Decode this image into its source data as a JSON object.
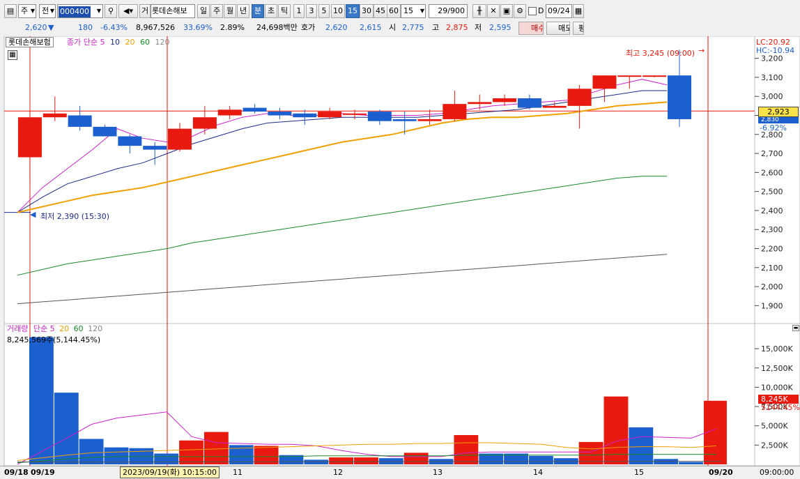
{
  "toolbar": {
    "type_select": "주",
    "market_select": "전",
    "code": "000400",
    "cat_btn": "거",
    "stock_name": "롯데손해보",
    "period_btns": [
      "일",
      "주",
      "월",
      "년",
      "분",
      "초",
      "틱"
    ],
    "interval_btns": [
      "1",
      "3",
      "5",
      "10",
      "15",
      "30",
      "45",
      "60"
    ],
    "interval_value": "15",
    "count": "29/900",
    "d_label": "D",
    "date_value": "09/24"
  },
  "quote": {
    "price": "2,620",
    "arrow": "▼",
    "change": "180",
    "change_pct": "-6.43%",
    "volume": "8,967,526",
    "turnover_pct": "33.69%",
    "vol_ratio": "2.89%",
    "amount": "24,698백만",
    "hoga_label": "호가",
    "ask": "2,620",
    "bid": "2,615",
    "open_label": "시",
    "open": "2,775",
    "high_label": "고",
    "high": "2,875",
    "low_label": "저",
    "low": "2,595",
    "buy_btn": "매수",
    "sell_btn": "매도",
    "eval_btn": "평"
  },
  "price_panel": {
    "stock_label": "롯데손해보험",
    "ma_legend": {
      "label": "종가 단순",
      "periods": [
        "5",
        "10",
        "20",
        "60",
        "120"
      ]
    },
    "max_annotation": "최고 3,245 (09:00)",
    "min_annotation": "최저 2,390 (15:30)",
    "lc_label": "LC:20.92",
    "hc_label": "HC:-10.94",
    "current_price_tag": "2,923",
    "hidden_tag": "2,830",
    "pct_tag": "-6.92%",
    "colors": {
      "up": "#e8190e",
      "down": "#1c5fcf",
      "ma5": "#cc22cc",
      "ma10": "#1a2a8a",
      "ma20": "#f0a000",
      "ma60": "#1a8a2a",
      "ma120": "#555555"
    }
  },
  "volume_panel": {
    "label": "거래량",
    "ma_legend": {
      "label": "단순",
      "periods": [
        "5",
        "20",
        "60",
        "120"
      ]
    },
    "info": "8,245,569주(5,144.45%)",
    "current_tag": "8,245K",
    "pct_tag": "5144.45%"
  },
  "xaxis": {
    "labels": [
      "09/18",
      "09/19",
      "11",
      "12",
      "13",
      "14",
      "15",
      "09/20"
    ],
    "crosshair_date": "2023/09/19(화) 10:15:00",
    "right_time": "09:00:00"
  },
  "chart_data": [
    {
      "type": "candlestick",
      "title": "롯데손해보험",
      "ylim": [
        1850,
        3250
      ],
      "yticks": [
        1900,
        2000,
        2100,
        2200,
        2300,
        2400,
        2500,
        2600,
        2700,
        2800,
        2900,
        3000,
        3100,
        3200
      ],
      "candles": [
        {
          "o": 2890,
          "h": 2910,
          "l": 2560,
          "c": 2680,
          "dir": "down",
          "color": "red"
        },
        {
          "o": 2890,
          "h": 3000,
          "l": 2870,
          "c": 2910,
          "dir": "up"
        },
        {
          "o": 2900,
          "h": 2950,
          "l": 2820,
          "c": 2840,
          "dir": "down"
        },
        {
          "o": 2840,
          "h": 2850,
          "l": 2790,
          "c": 2790,
          "dir": "down"
        },
        {
          "o": 2790,
          "h": 2800,
          "l": 2700,
          "c": 2740,
          "dir": "down"
        },
        {
          "o": 2740,
          "h": 2760,
          "l": 2640,
          "c": 2720,
          "dir": "down"
        },
        {
          "o": 2720,
          "h": 2860,
          "l": 2710,
          "c": 2830,
          "dir": "up"
        },
        {
          "o": 2830,
          "h": 2950,
          "l": 2800,
          "c": 2890,
          "dir": "up"
        },
        {
          "o": 2900,
          "h": 2950,
          "l": 2880,
          "c": 2930,
          "dir": "up"
        },
        {
          "o": 2940,
          "h": 2960,
          "l": 2910,
          "c": 2920,
          "dir": "down"
        },
        {
          "o": 2920,
          "h": 2940,
          "l": 2880,
          "c": 2900,
          "dir": "down"
        },
        {
          "o": 2910,
          "h": 2930,
          "l": 2850,
          "c": 2890,
          "dir": "down"
        },
        {
          "o": 2890,
          "h": 2940,
          "l": 2880,
          "c": 2920,
          "dir": "up"
        },
        {
          "o": 2910,
          "h": 2930,
          "l": 2880,
          "c": 2910,
          "dir": "flat"
        },
        {
          "o": 2920,
          "h": 2930,
          "l": 2850,
          "c": 2870,
          "dir": "down"
        },
        {
          "o": 2880,
          "h": 2920,
          "l": 2800,
          "c": 2870,
          "dir": "down"
        },
        {
          "o": 2870,
          "h": 2930,
          "l": 2850,
          "c": 2880,
          "dir": "up"
        },
        {
          "o": 2880,
          "h": 3030,
          "l": 2870,
          "c": 2960,
          "dir": "up"
        },
        {
          "o": 2960,
          "h": 3010,
          "l": 2930,
          "c": 2970,
          "dir": "up"
        },
        {
          "o": 2970,
          "h": 3010,
          "l": 2950,
          "c": 2990,
          "dir": "up"
        },
        {
          "o": 2990,
          "h": 3010,
          "l": 2930,
          "c": 2940,
          "dir": "down"
        },
        {
          "o": 2940,
          "h": 2970,
          "l": 2940,
          "c": 2950,
          "dir": "flat"
        },
        {
          "o": 2950,
          "h": 3060,
          "l": 2830,
          "c": 3040,
          "dir": "up"
        },
        {
          "o": 3040,
          "h": 3110,
          "l": 2970,
          "c": 3110,
          "dir": "up"
        },
        {
          "o": 3110,
          "h": 3110,
          "l": 3040,
          "c": 3110,
          "dir": "flat"
        },
        {
          "o": 3110,
          "h": 3110,
          "l": 3100,
          "c": 3110,
          "dir": "flat"
        },
        {
          "o": 3110,
          "h": 3245,
          "l": 2840,
          "c": 2880,
          "dir": "down"
        }
      ],
      "ma": {
        "ma5": [
          2390,
          2520,
          2620,
          2720,
          2830,
          2780,
          2760,
          2790,
          2850,
          2890,
          2910,
          2900,
          2900,
          2910,
          2900,
          2900,
          2900,
          2910,
          2930,
          2950,
          2960,
          2970,
          2980,
          3020,
          3060,
          3090,
          3060
        ],
        "ma10": [
          2390,
          2470,
          2540,
          2580,
          2620,
          2650,
          2700,
          2750,
          2790,
          2830,
          2860,
          2870,
          2880,
          2890,
          2890,
          2890,
          2890,
          2900,
          2910,
          2920,
          2930,
          2950,
          2970,
          2990,
          3010,
          3030,
          3030
        ],
        "ma20": [
          2390,
          2420,
          2450,
          2480,
          2500,
          2520,
          2550,
          2580,
          2610,
          2640,
          2670,
          2700,
          2730,
          2760,
          2780,
          2800,
          2830,
          2860,
          2880,
          2890,
          2890,
          2900,
          2910,
          2930,
          2950,
          2960,
          2970
        ],
        "ma60": [
          2060,
          2090,
          2120,
          2140,
          2160,
          2180,
          2200,
          2230,
          2250,
          2270,
          2290,
          2310,
          2330,
          2350,
          2370,
          2390,
          2410,
          2430,
          2450,
          2470,
          2490,
          2510,
          2530,
          2550,
          2570,
          2580,
          2580
        ],
        "ma120": [
          1910,
          1920,
          1930,
          1940,
          1950,
          1960,
          1970,
          1980,
          1990,
          2000,
          2010,
          2020,
          2030,
          2040,
          2050,
          2060,
          2070,
          2080,
          2090,
          2100,
          2110,
          2120,
          2130,
          2140,
          2150,
          2160,
          2170
        ]
      }
    },
    {
      "type": "bar",
      "title": "거래량",
      "ylim": [
        0,
        17000
      ],
      "yticks": [
        2500,
        5000,
        7500,
        10000,
        12500,
        15000
      ],
      "yticks_labels": [
        "2,500K",
        "5,000K",
        "7,500K",
        "10,000K",
        "12,500K",
        "15,000K"
      ],
      "values": [
        16500,
        9300,
        3300,
        2200,
        2100,
        1400,
        3100,
        4200,
        2500,
        2400,
        1200,
        600,
        900,
        900,
        800,
        1500,
        700,
        3800,
        1400,
        1400,
        1100,
        800,
        2900,
        8800,
        4800,
        700,
        300,
        8245
      ],
      "colors": [
        "down",
        "down",
        "down",
        "down",
        "down",
        "down",
        "up",
        "up",
        "down",
        "up",
        "down",
        "down",
        "up",
        "up",
        "down",
        "up",
        "down",
        "up",
        "down",
        "down",
        "down",
        "down",
        "up",
        "up",
        "down",
        "down",
        "down",
        "up"
      ],
      "ma5": [
        0,
        3400,
        5200,
        6000,
        6400,
        6800,
        3600,
        2800,
        2700,
        2600,
        2600,
        2400,
        1800,
        1300,
        1000,
        1000,
        1000,
        1500,
        1600,
        1600,
        1600,
        1600,
        1600,
        3000,
        3600,
        3500,
        3400,
        4600
      ],
      "ma20": [
        500,
        1200,
        1500,
        1600,
        1700,
        1800,
        1900,
        2000,
        2100,
        2200,
        2300,
        2400,
        2500,
        2600,
        2600,
        2700,
        2700,
        2800,
        2800,
        2700,
        2600,
        2200,
        2000,
        2200,
        2300,
        2300,
        2200,
        2400
      ],
      "ma60": [
        200,
        700,
        900,
        1000,
        1000,
        1000,
        1000,
        1000,
        1000,
        1000,
        1000,
        1100,
        1100,
        1100,
        1100,
        1100,
        1100,
        1200,
        1200,
        1200,
        1200,
        1200,
        1200,
        1300,
        1300,
        1300,
        1300,
        1300
      ]
    }
  ]
}
